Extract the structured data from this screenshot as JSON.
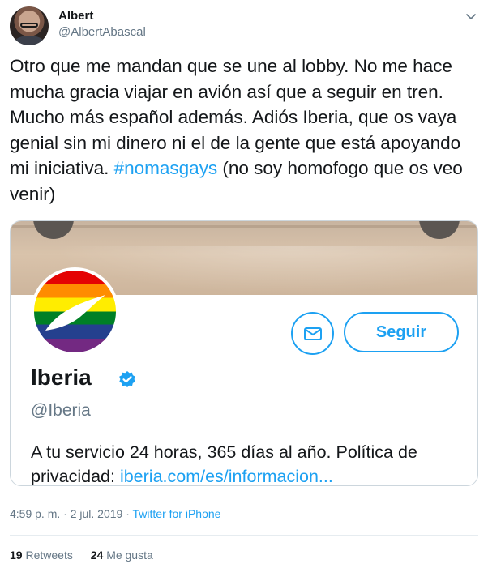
{
  "author": {
    "name": "Albert",
    "handle": "@AlbertAbascal"
  },
  "tweet": {
    "text_main": "Otro que me mandan que se une al lobby. No me hace mucha gracia viajar en avión así que a seguir en tren. Mucho más español además. Adiós Iberia, que os vaya genial sin mi dinero ni el de la gente que está apoyando mi iniciativa. ",
    "hashtag": "#nomasgays",
    "text_tail": " (no soy homofogo que os veo venir)"
  },
  "embedded_profile": {
    "follow_label": "Seguir",
    "name": "Iberia",
    "handle": "@Iberia",
    "bio": "A tu servicio 24 horas, 365 días al año. Política de privacidad: ",
    "bio_link": "iberia.com/es/informacion..."
  },
  "meta": {
    "time_date": "4:59 p. m. · 2 jul. 2019 · ",
    "source": "Twitter for iPhone"
  },
  "stats": {
    "retweets_count": "19",
    "retweets_label": "Retweets",
    "likes_count": "24",
    "likes_label": "Me gusta"
  },
  "colors": {
    "link": "#1da1f2",
    "secondary_text": "#657786",
    "border": "#ccd6dd"
  },
  "icons": [
    "caret-down-icon",
    "mail-icon",
    "verified-badge-icon",
    "back-icon",
    "more-icon"
  ]
}
